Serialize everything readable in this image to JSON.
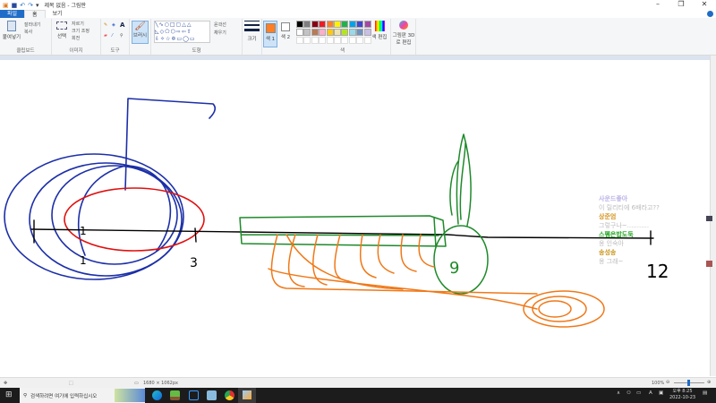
{
  "window": {
    "title": "제목 없음 - 그림판",
    "minimize": "–",
    "maximize": "❐",
    "close": "✕"
  },
  "tabs": [
    {
      "label": "파일"
    },
    {
      "label": "홈"
    },
    {
      "label": "보기"
    }
  ],
  "ribbon": {
    "clipboard": {
      "paste": "붙여넣기",
      "cut": "잘라내기",
      "copy": "복사",
      "group": "클립보드"
    },
    "image": {
      "select": "선택",
      "crop": "자르기",
      "resize": "크기 조정",
      "rotate": "회전",
      "group": "이미지"
    },
    "tools": {
      "group": "도구",
      "text_tool": "A"
    },
    "brushes": {
      "label": "브러시"
    },
    "shapes": {
      "outline": "윤곽선",
      "fill": "채우기",
      "group": "도형"
    },
    "size": {
      "label": "크기"
    },
    "color1": {
      "label": "색 1",
      "value": "#ff7f27"
    },
    "color2": {
      "label": "색 2",
      "value": "#ffffff"
    },
    "colors": {
      "group": "색",
      "edit": "색 편집",
      "palette": [
        "#000000",
        "#7f7f7f",
        "#880015",
        "#ed1c24",
        "#ff7f27",
        "#fff200",
        "#22b14c",
        "#00a2e8",
        "#3f48cc",
        "#a349a4",
        "#ffffff",
        "#c3c3c3",
        "#b97a57",
        "#ffaec9",
        "#ffc90e",
        "#efe4b0",
        "#b5e61d",
        "#99d9ea",
        "#7092be",
        "#c8bfe7"
      ]
    },
    "paint3d": {
      "label": "그림판 3D로 편집"
    }
  },
  "status": {
    "dimensions": "1680 × 1062px",
    "zoom": "100%"
  },
  "taskbar": {
    "search_placeholder": "검색하려면 여기에 입력하십시오",
    "time": "오후 8:25",
    "date": "2022-10-23"
  },
  "chat": [
    {
      "name": "사운드좋아",
      "color": "#b9b3e6",
      "text": "이 릴리티에 6배라고??"
    },
    {
      "name": "상준엄",
      "color": "#d4901c",
      "text": "그렇구나~..........."
    },
    {
      "name": "스펨은밥도둑",
      "color": "#1aa31a",
      "text": "옹 인숙아"
    },
    {
      "name": "송성송",
      "color": "#c9941c",
      "text": "옹 그래~"
    }
  ],
  "drawing": {
    "labels": [
      "1",
      "1",
      "3",
      "9",
      "12"
    ]
  }
}
